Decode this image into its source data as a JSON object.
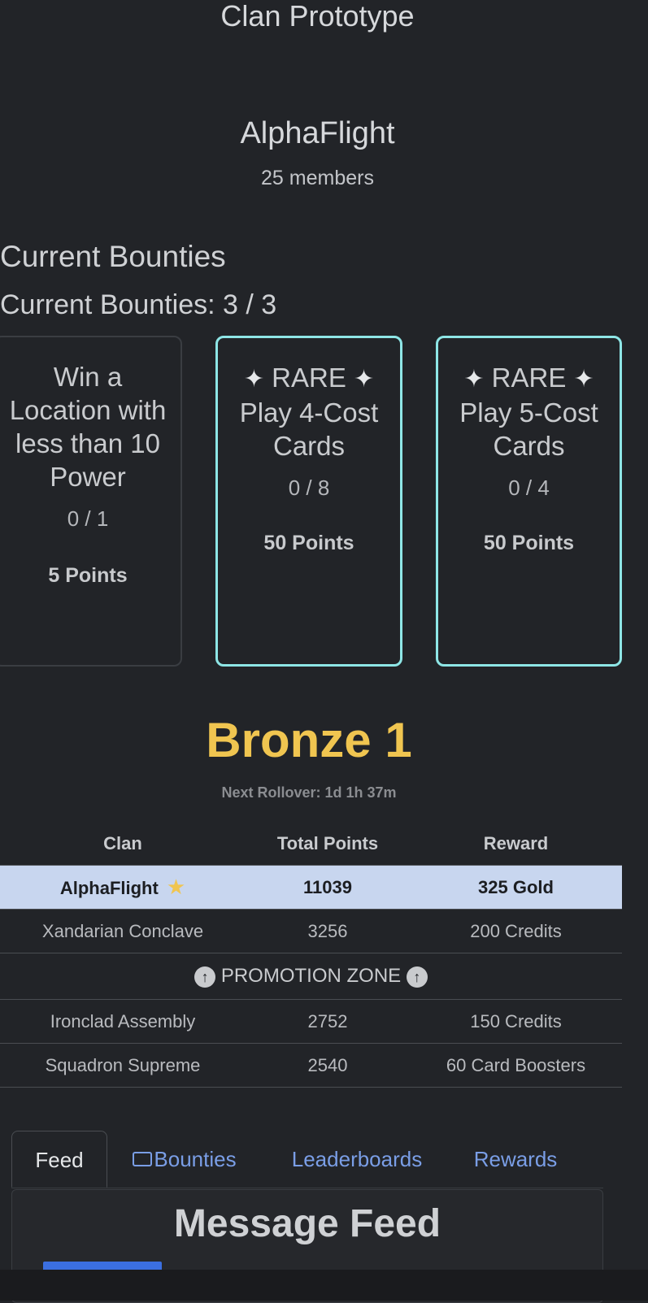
{
  "app": {
    "title": "Clan Prototype"
  },
  "clan": {
    "name": "AlphaFlight",
    "members": "25 members"
  },
  "bounties": {
    "section_title": "Current Bounties",
    "count_label": "Current Bounties: 3 / 3",
    "cards": [
      {
        "title": "Win a Location with less than 10 Power",
        "rare": false,
        "progress": "0 / 1",
        "points": "5 Points"
      },
      {
        "rare_label": "RARE",
        "title": "Play 4-Cost Cards",
        "rare": true,
        "progress": "0 / 8",
        "points": "50 Points"
      },
      {
        "rare_label": "RARE",
        "title": "Play 5-Cost Cards",
        "rare": true,
        "progress": "0 / 4",
        "points": "50 Points"
      }
    ]
  },
  "league": {
    "name": "Bronze 1",
    "rollover": "Next Rollover: 1d 1h 37m",
    "columns": [
      "Clan",
      "Total Points",
      "Reward"
    ],
    "rows": [
      {
        "clan": "AlphaFlight",
        "points": "11039",
        "reward": "325 Gold",
        "highlight": true
      },
      {
        "clan": "Xandarian Conclave",
        "points": "3256",
        "reward": "200 Credits"
      },
      {
        "clan": "Ironclad Assembly",
        "points": "2752",
        "reward": "150 Credits"
      },
      {
        "clan": "Squadron Supreme",
        "points": "2540",
        "reward": "60 Card Boosters"
      }
    ],
    "promotion_zone": "PROMOTION ZONE"
  },
  "tabs": [
    {
      "label": "Feed",
      "active": true
    },
    {
      "label": "Bounties",
      "icon": "list-card-icon"
    },
    {
      "label": "Leaderboards"
    },
    {
      "label": "Rewards"
    }
  ],
  "feed": {
    "title": "Message Feed"
  },
  "colors": {
    "accent": "#f0c550",
    "rare_border": "#8ee6e6",
    "link": "#7a9ee6",
    "highlight_row": "#c8d6ef"
  }
}
